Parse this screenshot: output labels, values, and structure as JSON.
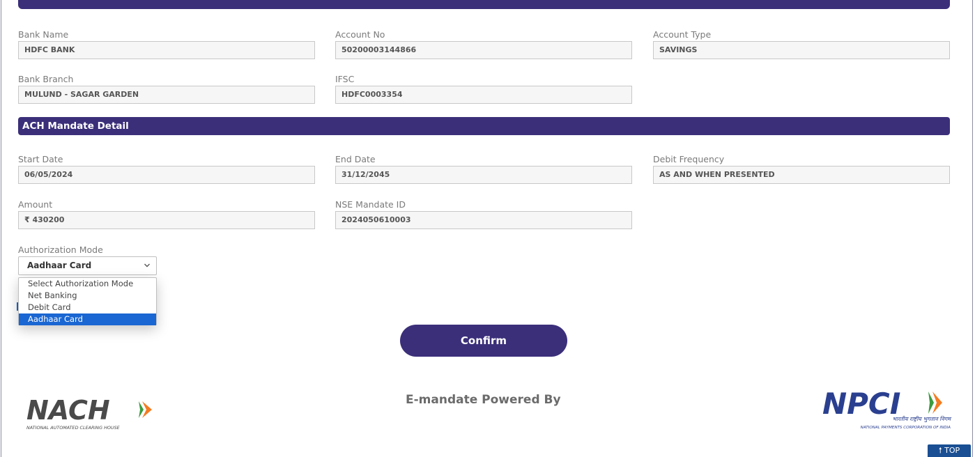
{
  "bank": {
    "bank_name": {
      "label": "Bank Name",
      "value": "HDFC BANK"
    },
    "account_no": {
      "label": "Account No",
      "value": "50200003144866"
    },
    "account_type": {
      "label": "Account Type",
      "value": "SAVINGS"
    },
    "bank_branch": {
      "label": "Bank Branch",
      "value": "MULUND - SAGAR GARDEN"
    },
    "ifsc": {
      "label": "IFSC",
      "value": "HDFC0003354"
    }
  },
  "mandate": {
    "section_title": "ACH Mandate Detail",
    "start_date": {
      "label": "Start Date",
      "value": "06/05/2024"
    },
    "end_date": {
      "label": "End Date",
      "value": "31/12/2045"
    },
    "debit_frequency": {
      "label": "Debit Frequency",
      "value": "AS AND WHEN PRESENTED"
    },
    "amount": {
      "label": "Amount",
      "value": "₹ 430200"
    },
    "nse_mandate_id": {
      "label": "NSE Mandate ID",
      "value": "2024050610003"
    }
  },
  "authorization": {
    "label": "Authorization Mode",
    "selected": "Aadhaar Card",
    "options": [
      "Select Authorization Mode",
      "Net Banking",
      "Debit Card",
      "Aadhaar Card"
    ]
  },
  "actions": {
    "confirm_label": "Confirm"
  },
  "footer": {
    "powered_by": "E-mandate Powered By",
    "nach_logo_text": "NACH",
    "nach_tagline": "NATIONAL AUTOMATED CLEARING HOUSE",
    "npci_logo_text": "NPCI",
    "npci_hindi": "भारतीय राष्ट्रीय भुगतान निगम",
    "npci_tagline": "NATIONAL PAYMENTS CORPORATION OF INDIA",
    "top_label": "TOP",
    "brand_color": "#3b2f7a",
    "accent_orange": "#f47b20",
    "accent_green": "#3a9b3f"
  }
}
